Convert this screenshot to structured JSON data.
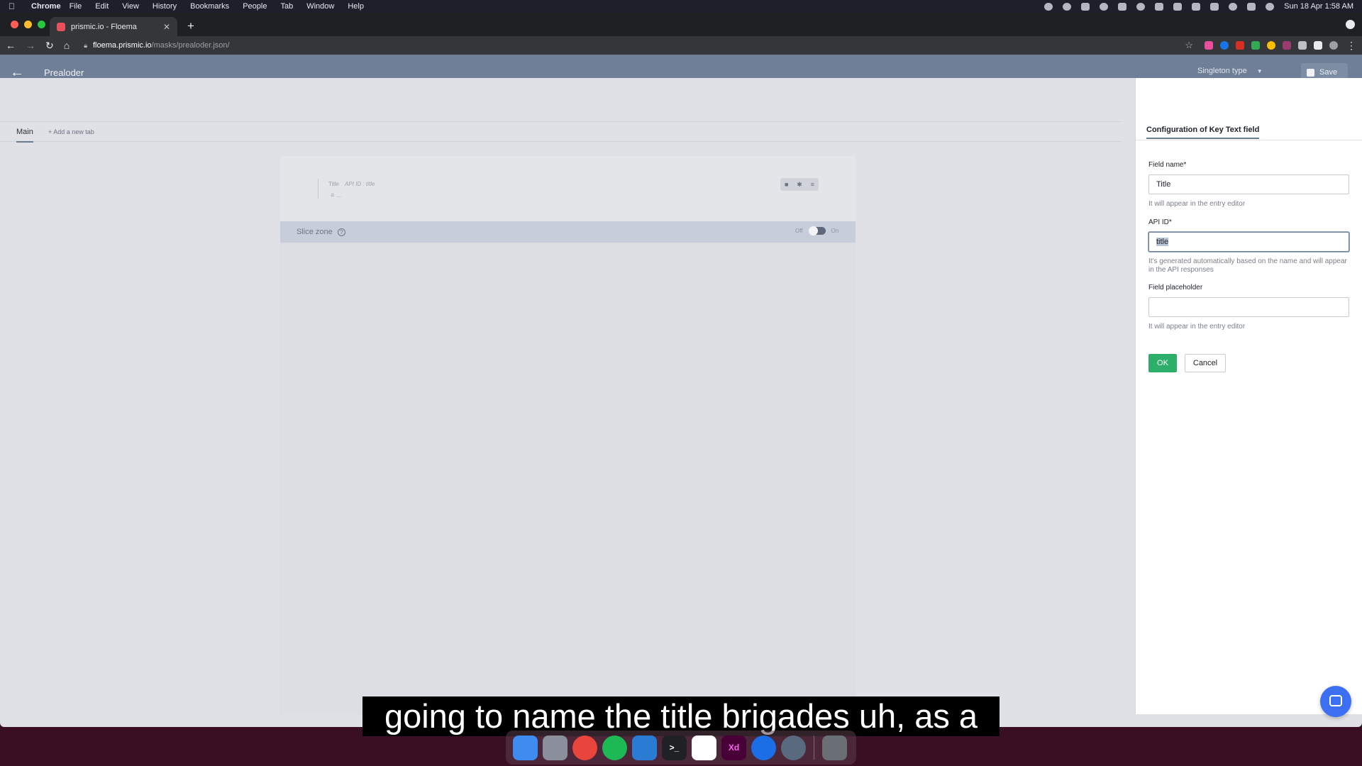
{
  "menubar": {
    "app_name": "Chrome",
    "menus": [
      "File",
      "Edit",
      "View",
      "History",
      "Bookmarks",
      "People",
      "Tab",
      "Window",
      "Help"
    ],
    "clock": "Sun 18 Apr  1:58 AM"
  },
  "browser": {
    "tab_title": "prismic.io - Floema",
    "url_host": "floema.prismic.io",
    "url_path": "/masks/prealoder.json/"
  },
  "header": {
    "title": "Prealoder",
    "type_select": "Singleton type",
    "save_label": "Save"
  },
  "editor": {
    "tabs": [
      {
        "label": "Main"
      }
    ],
    "add_tab_label": "Add a new tab",
    "field": {
      "label": "Title",
      "api_id": "API ID : title",
      "placeholder": "..."
    },
    "slice_zone_label": "Slice zone",
    "toggle_off": "Off",
    "toggle_on": "On"
  },
  "panel": {
    "title": "Configuration of Key Text field",
    "field_name_label": "Field name*",
    "field_name_value": "Title",
    "field_name_help": "It will appear in the entry editor",
    "api_id_label": "API ID*",
    "api_id_value": "title",
    "api_id_help": "It's generated automatically based on the name and will appear in the API responses",
    "placeholder_label": "Field placeholder",
    "placeholder_value": "",
    "placeholder_help": "It will appear in the entry editor",
    "ok_label": "OK",
    "cancel_label": "Cancel"
  },
  "caption": "going to name the title brigades uh, as a",
  "dock": {
    "apps": [
      {
        "name": "Finder",
        "color": "#3f8cf0"
      },
      {
        "name": "Launchpad",
        "color": "#8a8f9b"
      },
      {
        "name": "Chrome",
        "color": "#e8453c"
      },
      {
        "name": "Spotify",
        "color": "#1db954"
      },
      {
        "name": "VS Code",
        "color": "#2a7bd4"
      },
      {
        "name": "Terminal",
        "color": "#202124"
      },
      {
        "name": "Slack",
        "color": "#ffffff"
      },
      {
        "name": "Adobe XD",
        "color": "#470137"
      },
      {
        "name": "Maps",
        "color": "#1b6ee6"
      },
      {
        "name": "QuickTime",
        "color": "#5a6a7e"
      },
      {
        "name": "Trash",
        "color": "#6a6e75"
      }
    ],
    "xd_text": "Xd",
    "terminal_text": ">_"
  }
}
